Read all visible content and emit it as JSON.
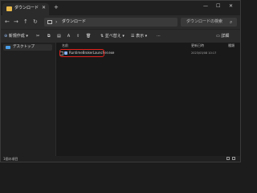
{
  "window": {
    "tab_title": "ダウンロード",
    "tab_close": "✕",
    "new_tab": "+",
    "minimize": "—",
    "maximize": "☐",
    "close": "✕"
  },
  "nav": {
    "back": "←",
    "forward": "→",
    "up": "↑",
    "refresh": "↻",
    "separator": "›",
    "address_path": "ダウンロード",
    "search_placeholder": "ダウンロードの検索",
    "search_icon": "search-icon"
  },
  "toolbar": {
    "new_label": "新規作成",
    "sort_label": "並べ替え",
    "view_label": "表示",
    "more": "···",
    "details_label": "詳細"
  },
  "sidebar": {
    "items": [
      {
        "label": "デスクトップ",
        "icon": "desktop-icon"
      }
    ]
  },
  "file_list": {
    "columns": [
      "名前",
      "更新日時",
      "種類"
    ],
    "rows": [
      {
        "name": "RuntimeBrokerLauncher.exe",
        "date": "2023/03/08 10:17",
        "selected": true
      }
    ]
  },
  "status": {
    "text": "1個の項目"
  },
  "colors": {
    "highlight": "#e0211c",
    "folder": "#e9b949",
    "accent": "#4a9ee8"
  }
}
